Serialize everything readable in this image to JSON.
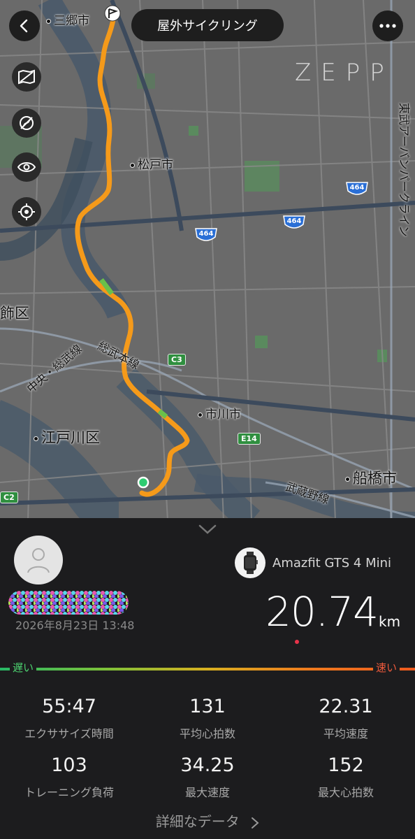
{
  "header": {
    "title": "屋外サイクリング",
    "back_icon": "chevron-left-icon",
    "menu_icon": "more-horizontal-icon",
    "logo": "ZEPP"
  },
  "map_tools": [
    {
      "name": "map-style-icon"
    },
    {
      "name": "hide-route-icon"
    },
    {
      "name": "eye-icon"
    },
    {
      "name": "locate-icon"
    }
  ],
  "map_labels": {
    "misato": "三郷市",
    "matsudo": "松戸市",
    "katsushika": "飾区",
    "edogawa": "江戸川区",
    "ichikawa": "市川市",
    "funabashi": "船橋市",
    "chuo_sobu": "中央・総武線",
    "sobu_honsen": "総武本線",
    "musashino": "武蔵野線",
    "tobu_urban": "東武アーバンパークライン",
    "route464_a": "464",
    "route464_b": "464",
    "route464_c": "464",
    "c3": "C3",
    "e14": "E14",
    "c2": "C2"
  },
  "device": {
    "name": "Amazfit GTS 4 Mini",
    "icon": "smartwatch-icon"
  },
  "activity": {
    "username_masked": "●●●●●●●●●●●",
    "datetime": "2026年8月23日 13:48",
    "distance": "20.74",
    "distance_unit": "km"
  },
  "speed_scale": {
    "slow": "遅い",
    "fast": "速い"
  },
  "stats": [
    {
      "value": "55:47",
      "label": "エクササイズ時間"
    },
    {
      "value": "131",
      "label": "平均心拍数"
    },
    {
      "value": "22.31",
      "label": "平均速度"
    },
    {
      "value": "103",
      "label": "トレーニング負荷"
    },
    {
      "value": "34.25",
      "label": "最大速度"
    },
    {
      "value": "152",
      "label": "最大心拍数"
    }
  ],
  "detail_link": "詳細なデータ",
  "colors": {
    "route": "#f59a1a",
    "map_bg": "#6a6a6a",
    "panel_bg": "#1c1c1e",
    "slow": "#4cd06f",
    "fast": "#f05a3c"
  }
}
